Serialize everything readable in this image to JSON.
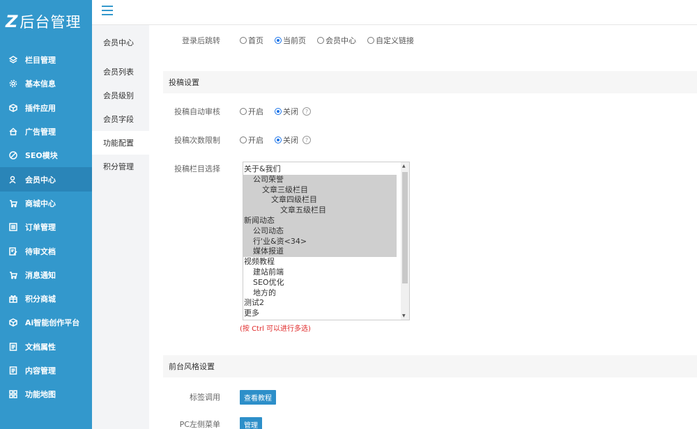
{
  "logo": {
    "mark": "Z",
    "text": "后台管理"
  },
  "sidebar": {
    "items": [
      {
        "label": "栏目管理",
        "icon": "layers-icon"
      },
      {
        "label": "基本信息",
        "icon": "gear-icon"
      },
      {
        "label": "插件应用",
        "icon": "cube-icon"
      },
      {
        "label": "广告管理",
        "icon": "home-icon"
      },
      {
        "label": "SEO模块",
        "icon": "compass-icon"
      },
      {
        "label": "会员中心",
        "icon": "user-icon",
        "active": true
      },
      {
        "label": "商城中心",
        "icon": "cart-icon"
      },
      {
        "label": "订单管理",
        "icon": "list-icon"
      },
      {
        "label": "待审文档",
        "icon": "edit-doc-icon"
      },
      {
        "label": "消息通知",
        "icon": "cart-icon"
      },
      {
        "label": "积分商城",
        "icon": "gift-icon"
      },
      {
        "label": "Ai智能创作平台",
        "icon": "cube-icon"
      },
      {
        "label": "文档属性",
        "icon": "doc-icon"
      },
      {
        "label": "内容管理",
        "icon": "doc-icon"
      },
      {
        "label": "功能地图",
        "icon": "grid-icon"
      }
    ]
  },
  "submenu": {
    "title": "会员中心",
    "items": [
      "会员列表",
      "会员级别",
      "会员字段",
      "功能配置",
      "积分管理"
    ],
    "active_index": 3
  },
  "main": {
    "redirect": {
      "label": "登录后跳转",
      "options": [
        "首页",
        "当前页",
        "会员中心",
        "自定义链接"
      ],
      "selected": 1
    },
    "section_submit": "投稿设置",
    "auto_review": {
      "label": "投稿自动审核",
      "options": [
        "开启",
        "关闭"
      ],
      "selected": 1
    },
    "count_limit": {
      "label": "投稿次数限制",
      "options": [
        "开启",
        "关闭"
      ],
      "selected": 1
    },
    "columns": {
      "label": "投稿栏目选择",
      "items": [
        {
          "text": "关于&我们",
          "indent": 0,
          "sel": false
        },
        {
          "text": "公司荣誉",
          "indent": 1,
          "sel": true
        },
        {
          "text": "文章三级栏目",
          "indent": 2,
          "sel": true
        },
        {
          "text": "文章四级栏目",
          "indent": 3,
          "sel": true
        },
        {
          "text": "文章五级栏目",
          "indent": 4,
          "sel": true
        },
        {
          "text": "新闻动态",
          "indent": 0,
          "sel": true
        },
        {
          "text": "公司动态",
          "indent": 1,
          "sel": true
        },
        {
          "text": "行'业&资<34>",
          "indent": 1,
          "sel": true
        },
        {
          "text": "媒体报道",
          "indent": 1,
          "sel": true
        },
        {
          "text": "视频教程",
          "indent": 0,
          "sel": false
        },
        {
          "text": "建站前端",
          "indent": 1,
          "sel": false
        },
        {
          "text": "SEO优化",
          "indent": 1,
          "sel": false
        },
        {
          "text": "地方的",
          "indent": 1,
          "sel": false
        },
        {
          "text": "测试2",
          "indent": 0,
          "sel": false
        },
        {
          "text": "更多",
          "indent": 0,
          "sel": false
        }
      ],
      "tip": "(按 Ctrl 可以进行多选)"
    },
    "section_style": "前台风格设置",
    "tag_call": {
      "label": "标签调用",
      "button": "查看教程"
    },
    "pc_menu": {
      "label": "PC左侧菜单",
      "button": "管理"
    },
    "help_icon": "?"
  }
}
